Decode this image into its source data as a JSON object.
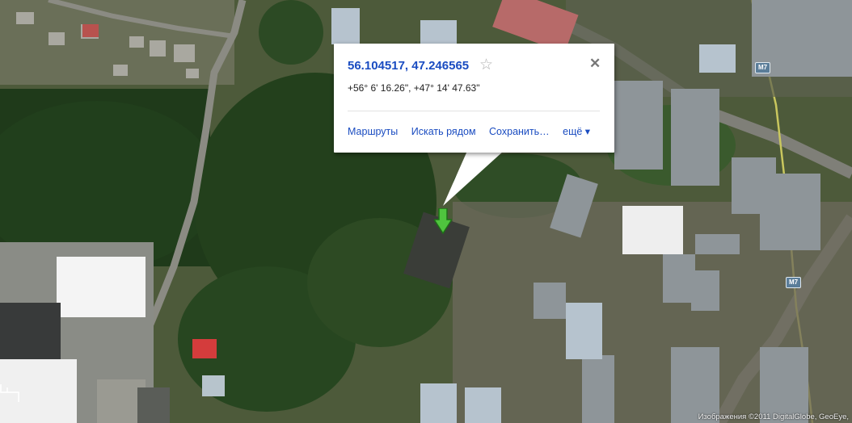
{
  "popup": {
    "title": "56.104517, 47.246565",
    "star_icon": "☆",
    "close_icon": "✕",
    "dms": "+56° 6' 16.26\", +47° 14' 47.63\"",
    "actions": {
      "routes": "Маршруты",
      "search_nearby": "Искать рядом",
      "save": "Сохранить…",
      "more": "ещё ▾"
    }
  },
  "roads": {
    "m7_a": "M7",
    "m7_b": "M7"
  },
  "copyright": "Изображения ©2011 DigitalGlobe, GeoEye,",
  "icons": {
    "marker": "green-arrow-marker-icon",
    "favorite": "star-icon",
    "close": "close-icon"
  }
}
